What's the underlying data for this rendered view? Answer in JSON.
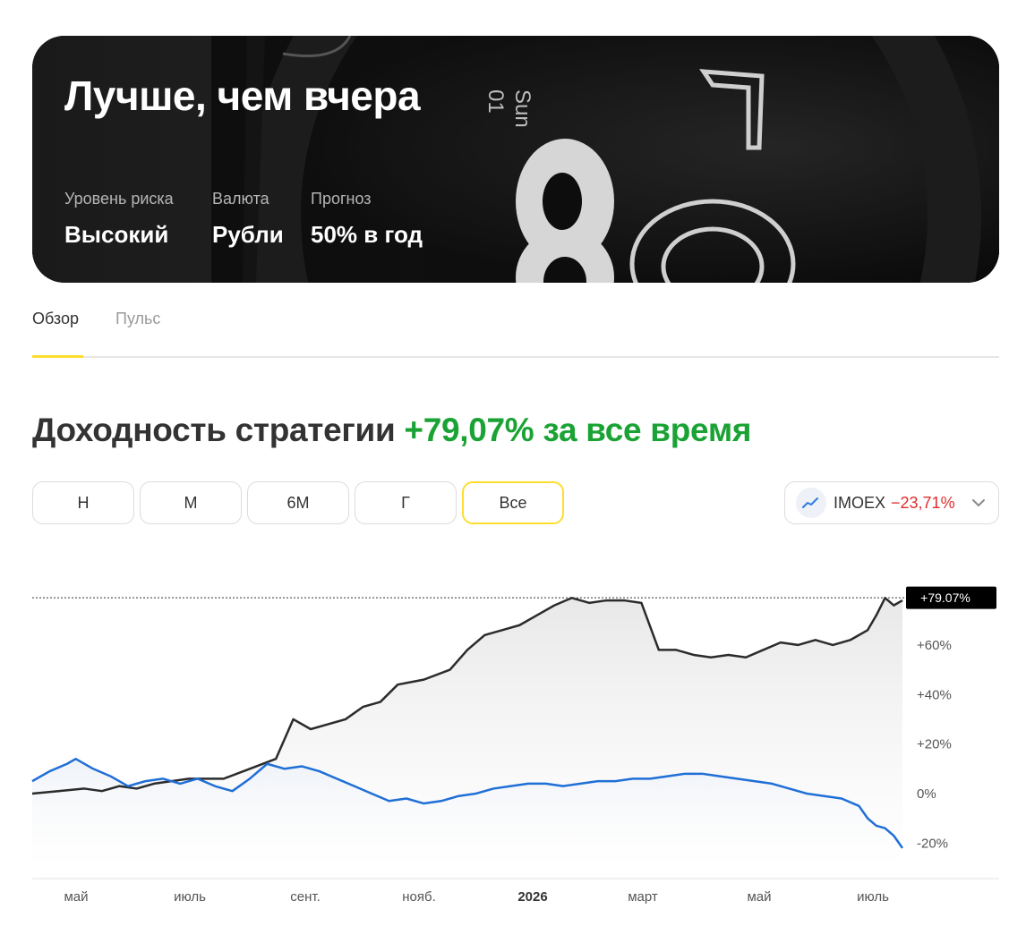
{
  "hero": {
    "title": "Лучше, чем вчера",
    "meta": [
      {
        "label": "Уровень риска",
        "value": "Высокий"
      },
      {
        "label": "Валюта",
        "value": "Рубли"
      },
      {
        "label": "Прогноз",
        "value": "50% в год"
      }
    ],
    "background_text": {
      "day": "Sun",
      "date": "01"
    }
  },
  "tabs": [
    {
      "label": "Обзор",
      "active": true
    },
    {
      "label": "Пульс",
      "active": false
    }
  ],
  "headline": {
    "prefix": "Доходность стратегии",
    "value": "+79,07% за все время"
  },
  "periods": [
    {
      "label": "Н",
      "active": false
    },
    {
      "label": "М",
      "active": false
    },
    {
      "label": "6М",
      "active": false
    },
    {
      "label": "Г",
      "active": false
    },
    {
      "label": "Все",
      "active": true
    }
  ],
  "benchmark": {
    "icon": "trend-line-icon",
    "name": "IMOEX",
    "change": "−23,71%"
  },
  "colors": {
    "accent": "#ffdd2d",
    "positive": "#1aa334",
    "negative": "#e02d2d",
    "strategy_line": "#2b2b2b",
    "benchmark_line": "#1f6fd6"
  },
  "chart_data": {
    "type": "line",
    "x_ticks": [
      "май",
      "июль",
      "сент.",
      "нояб.",
      "2026",
      "март",
      "май",
      "июль"
    ],
    "y_ticks": [
      "+60%",
      "+40%",
      "+20%",
      "0%",
      "-20%"
    ],
    "y_values": [
      60,
      40,
      20,
      0,
      -20
    ],
    "ylim": [
      -30,
      82
    ],
    "current_label": "+79.07%",
    "current_value": 79.07,
    "series": [
      {
        "key": "strategy",
        "x": [
          0,
          3,
          6,
          8,
          10,
          12,
          14,
          16,
          18,
          20,
          22,
          25,
          28,
          30,
          32,
          34,
          36,
          38,
          40,
          42,
          45,
          48,
          50,
          52,
          54,
          56,
          58,
          60,
          62,
          64,
          66,
          68,
          70,
          72,
          74,
          76,
          78,
          80,
          82,
          84,
          86,
          88,
          90,
          92,
          94,
          96,
          97,
          98,
          99,
          100
        ],
        "values": [
          0,
          1,
          2,
          1,
          3,
          2,
          4,
          5,
          6,
          6,
          6,
          10,
          14,
          30,
          26,
          28,
          30,
          35,
          37,
          44,
          46,
          50,
          58,
          64,
          66,
          68,
          72,
          76,
          79,
          77,
          78,
          78,
          77,
          58,
          58,
          56,
          55,
          56,
          55,
          58,
          61,
          60,
          62,
          60,
          62,
          66,
          72,
          79,
          76,
          78
        ]
      },
      {
        "key": "imoex",
        "x": [
          0,
          2,
          4,
          5,
          7,
          9,
          11,
          13,
          15,
          17,
          19,
          21,
          23,
          25,
          27,
          29,
          31,
          33,
          35,
          37,
          39,
          41,
          43,
          45,
          47,
          49,
          51,
          53,
          55,
          57,
          59,
          61,
          63,
          65,
          67,
          69,
          71,
          73,
          75,
          77,
          79,
          81,
          83,
          85,
          87,
          89,
          91,
          93,
          95,
          96,
          97,
          98,
          99,
          100
        ],
        "values": [
          5,
          9,
          12,
          14,
          10,
          7,
          3,
          5,
          6,
          4,
          6,
          3,
          1,
          6,
          12,
          10,
          11,
          9,
          6,
          3,
          0,
          -3,
          -2,
          -4,
          -3,
          -1,
          0,
          2,
          3,
          4,
          4,
          3,
          4,
          5,
          5,
          6,
          6,
          7,
          8,
          8,
          7,
          6,
          5,
          4,
          2,
          0,
          -1,
          -2,
          -5,
          -10,
          -13,
          -14,
          -17,
          -22
        ]
      }
    ],
    "grid": false
  }
}
